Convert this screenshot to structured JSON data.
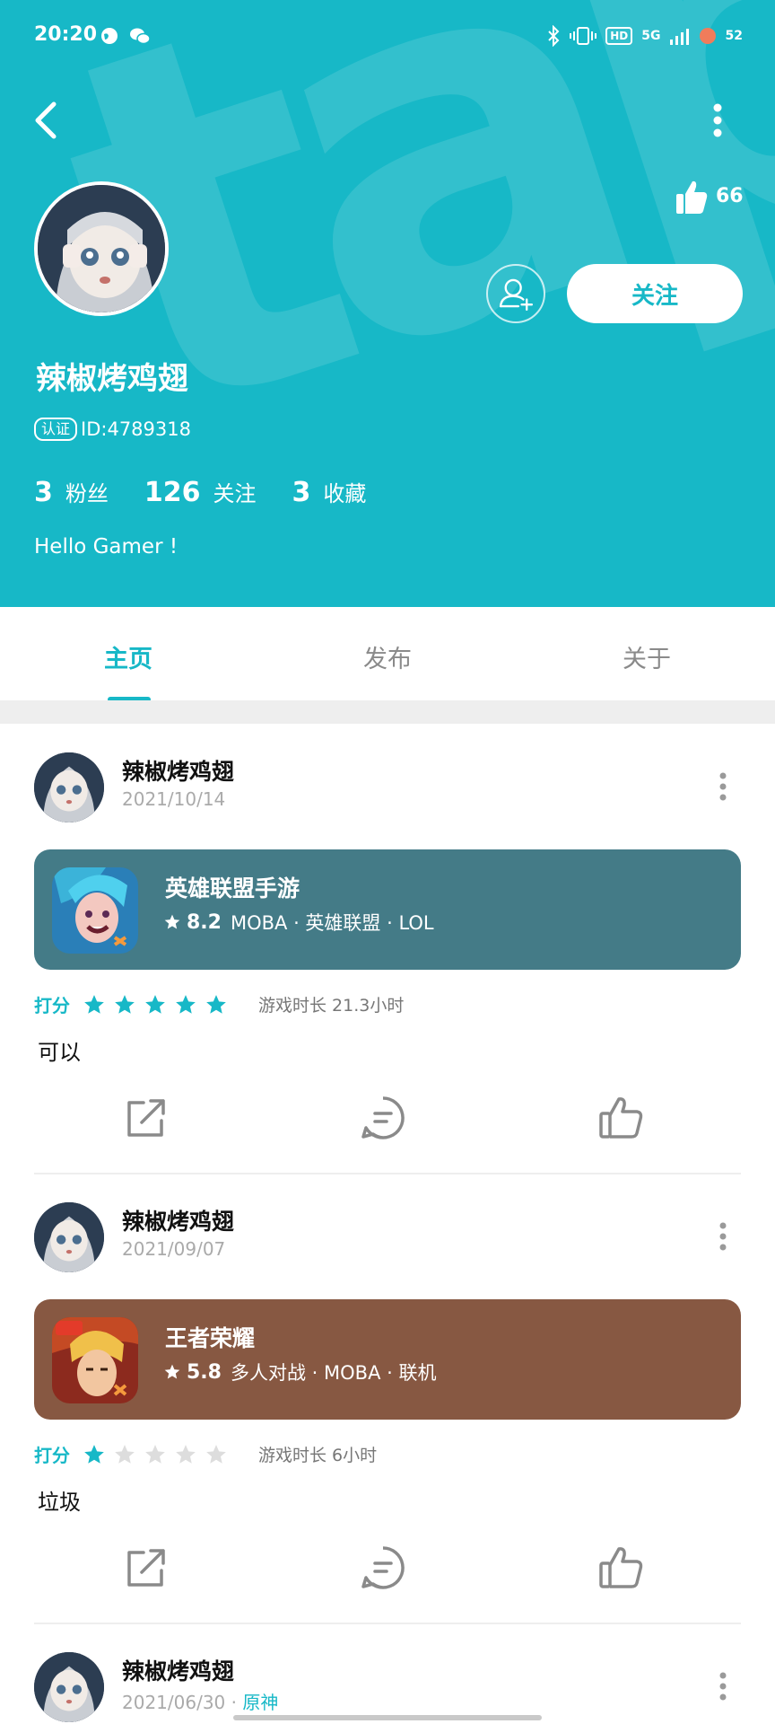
{
  "status_bar": {
    "time": "20:20",
    "hd": "HD",
    "network": "5G",
    "battery": "52"
  },
  "profile": {
    "likes": "66",
    "username": "辣椒烤鸡翅",
    "id_tag": "认证",
    "id_text": "ID:4789318",
    "follow_label": "关注",
    "stats": [
      {
        "num": "3",
        "label": "粉丝"
      },
      {
        "num": "126",
        "label": "关注"
      },
      {
        "num": "3",
        "label": "收藏"
      }
    ],
    "bio": "Hello Gamer !",
    "header_color": "#17b8c7"
  },
  "tabs": [
    {
      "label": "主页",
      "active": true
    },
    {
      "label": "发布",
      "active": false
    },
    {
      "label": "关于",
      "active": false
    }
  ],
  "posts": [
    {
      "author": "辣椒烤鸡翅",
      "date": "2021/10/14",
      "game": {
        "title": "英雄联盟手游",
        "rating": "8.2",
        "tags": "MOBA · 英雄联盟 · LOL",
        "card_color": "#447b87"
      },
      "rating_label": "打分",
      "stars": 5,
      "playtime": "游戏时长 21.3小时",
      "comment": "可以"
    },
    {
      "author": "辣椒烤鸡翅",
      "date": "2021/09/07",
      "game": {
        "title": "王者荣耀",
        "rating": "5.8",
        "tags": "多人对战 · MOBA · 联机",
        "card_color": "#875842"
      },
      "rating_label": "打分",
      "stars": 1,
      "playtime": "游戏时长 6小时",
      "comment": "垃圾"
    },
    {
      "author": "辣椒烤鸡翅",
      "date": "2021/06/30",
      "date_tag": "原神"
    }
  ],
  "icons": {
    "back": "back-arrow-icon",
    "more": "more-vertical-icon",
    "like": "thumbs-up-icon",
    "add_friend": "add-friend-icon",
    "share": "share-icon",
    "comment": "comment-icon"
  }
}
